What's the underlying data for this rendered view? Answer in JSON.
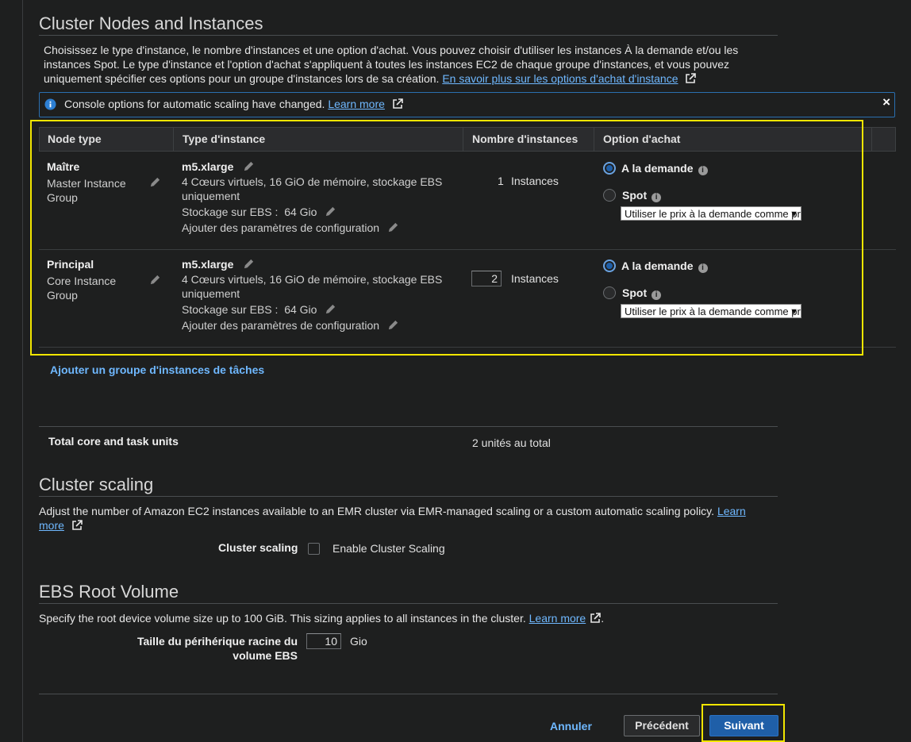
{
  "nodes_section": {
    "title": "Cluster Nodes and Instances",
    "description": "Choisissez le type d'instance, le nombre d'instances et une option d'achat. Vous pouvez choisir d'utiliser les instances À la demande et/ou les instances Spot. Le type d'instance et l'option d'achat s'appliquent à toutes les instances EC2 de chaque groupe d'instances, et vous pouvez uniquement spécifier ces options pour un groupe d'instances lors de sa création.",
    "learn_more_link": "En savoir plus sur les options d'achat d'instance",
    "banner": {
      "text": "Console options for automatic scaling have changed.",
      "link": "Learn more",
      "close": "×"
    },
    "table": {
      "headers": [
        "Node type",
        "Type d'instance",
        "Nombre d'instances",
        "Option d'achat"
      ],
      "rows": [
        {
          "node_label": "Maître",
          "group_name": "Master Instance Group",
          "instance_type": "m5.xlarge",
          "instance_desc": "4 Cœurs virtuels, 16 GiO de mémoire, stockage EBS uniquement",
          "ebs_label": "Stockage sur EBS :",
          "ebs_value": "64 Gio",
          "config_link": "Ajouter des paramètres de configuration",
          "count": "1",
          "count_unit": "Instances",
          "on_demand": "A la demande",
          "spot": "Spot",
          "select_value": "Utiliser le prix à la demande comme prix maximum"
        },
        {
          "node_label": "Principal",
          "group_name": "Core Instance Group",
          "instance_type": "m5.xlarge",
          "instance_desc": "4 Cœurs virtuels, 16 GiO de mémoire, stockage EBS uniquement",
          "ebs_label": "Stockage sur EBS :",
          "ebs_value": "64 Gio",
          "config_link": "Ajouter des paramètres de configuration",
          "count": "2",
          "count_unit": "Instances",
          "on_demand": "A la demande",
          "spot": "Spot",
          "select_value": "Utiliser le prix à la demande comme prix maximum"
        }
      ]
    },
    "add_task_group": "Ajouter un groupe d'instances de tâches",
    "total_label": "Total core and task units",
    "total_value": "2 unités au total"
  },
  "scaling_section": {
    "title": "Cluster scaling",
    "description": "Adjust the number of Amazon EC2 instances available to an EMR cluster via EMR-managed scaling or a custom automatic scaling policy.",
    "learn_more_a": "Learn",
    "learn_more_b": "more",
    "field_label": "Cluster scaling",
    "checkbox_label": "Enable Cluster Scaling"
  },
  "ebs_section": {
    "title": "EBS Root Volume",
    "description": "Specify the root device volume size up to 100 GiB. This sizing applies to all instances in the cluster.",
    "learn_more": "Learn more",
    "field_label_1": "Taille du périhérique racine du",
    "field_label_2": "volume EBS",
    "value": "10",
    "unit": "Gio"
  },
  "footer": {
    "cancel": "Annuler",
    "previous": "Précédent",
    "next": "Suivant"
  },
  "colors": {
    "background": "#1e1f1f",
    "link": "#6fb8ff",
    "primary_button": "#1f5fa8",
    "highlight": "#f2e600"
  }
}
